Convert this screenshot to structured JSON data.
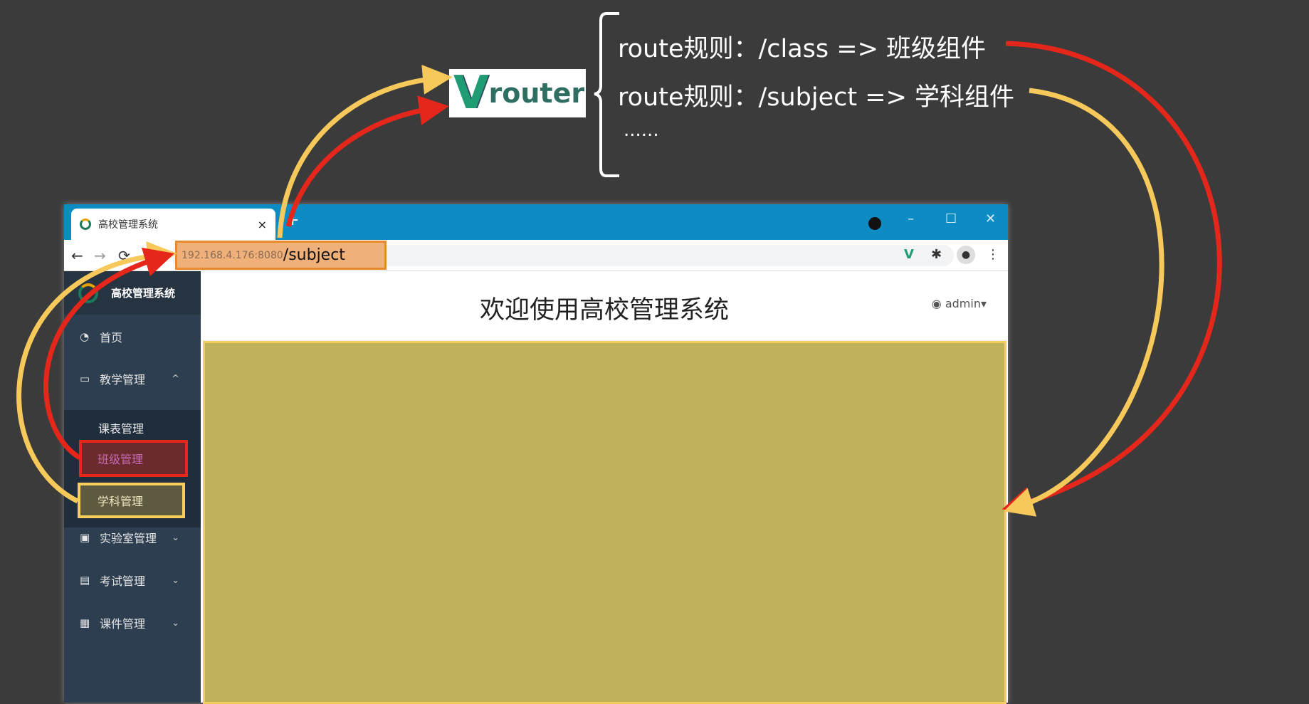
{
  "router_logo": {
    "mark": "V",
    "text": "router"
  },
  "rules": [
    "route规则：/class =>  班级组件",
    "route规则：/subject => 学科组件",
    "......"
  ],
  "browser": {
    "tab_title": "高校管理系统",
    "tab_close": "×",
    "new_tab": "+",
    "controls": {
      "minimize": "–",
      "maximize": "☐",
      "close": "✕"
    },
    "url_host": "192.168.4.176:8080",
    "url_path": "/subject",
    "nav": {
      "back": "←",
      "forward": "→",
      "reload": "⟳"
    },
    "toolbar": {
      "vue": "V",
      "extensions": "✱",
      "profile": "●",
      "menu": "⋮"
    }
  },
  "app": {
    "logo_text": "高校管理系统",
    "header_title": "欢迎使用高校管理系统",
    "user": "admin▾",
    "menu": [
      {
        "label": "首页",
        "icon": "dashboard-icon"
      },
      {
        "label": "教学管理",
        "icon": "monitor-icon",
        "chevron": "^"
      },
      {
        "label": "实验室管理",
        "icon": "lab-icon",
        "chevron": "⌄"
      },
      {
        "label": "考试管理",
        "icon": "exam-icon",
        "chevron": "⌄"
      },
      {
        "label": "课件管理",
        "icon": "courseware-icon",
        "chevron": "⌄"
      }
    ],
    "submenu": [
      "课表管理",
      "班级管理",
      "学科管理"
    ]
  },
  "colors": {
    "red_arrow": "#e5261b",
    "yellow_arrow": "#f6c95a",
    "content": "#bfb25a",
    "tabbar": "#0c8cc2"
  }
}
